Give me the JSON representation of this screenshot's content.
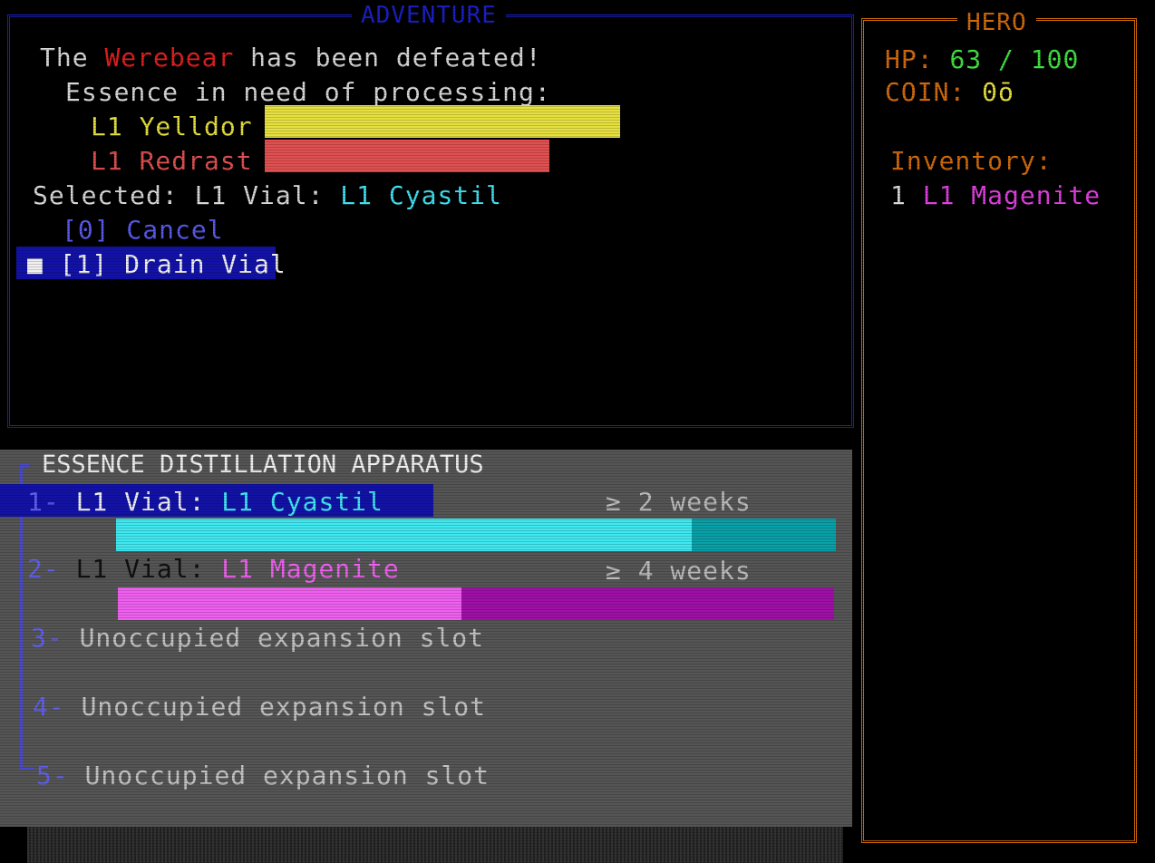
{
  "adventure": {
    "title": "ADVENTURE",
    "line1": {
      "prefix": "The ",
      "enemy": "Werebear",
      "suffix": " has been defeated!"
    },
    "essence_heading": "Essence in need of processing:",
    "essences": [
      {
        "label": "L1 Yelldor",
        "color": "#e6e040",
        "fill": 1.0
      },
      {
        "label": "L1 Redrast",
        "color": "#e05050",
        "fill": 0.8
      }
    ],
    "selected_prefix": "Selected: L1 Vial: ",
    "selected_value": "L1 Cyastil",
    "options": [
      {
        "label": "[0] Cancel"
      },
      {
        "label": "[1] Drain Vial",
        "marker": "■"
      }
    ]
  },
  "hero": {
    "title": "HERO",
    "hp_label": "HP: ",
    "hp_value": "63 / 100",
    "coin_label": "COIN: ",
    "coin_value": "0ō",
    "inventory_label": "Inventory:",
    "inventory": [
      {
        "qty": "1",
        "name": "L1 Magenite",
        "color": "#e040e0"
      }
    ]
  },
  "apparatus": {
    "title": "ESSENCE DISTILLATION APPARATUS",
    "slots": [
      {
        "num": "1-",
        "prefix": "L1 Vial: ",
        "name": "L1 Cyastil",
        "time": "≥ 2 weeks",
        "progress": 0.8,
        "color": "#40e8f0",
        "dark": "#0aa0a8"
      },
      {
        "num": "2-",
        "prefix": "L1 Vial: ",
        "name": "L1 Magenite",
        "time": "≥ 4 weeks",
        "progress": 0.48,
        "color": "#f060f0",
        "dark": "#a010a8"
      },
      {
        "num": "3-",
        "text": "Unoccupied expansion slot"
      },
      {
        "num": "4-",
        "text": "Unoccupied expansion slot"
      },
      {
        "num": "5-",
        "text": "Unoccupied expansion slot"
      }
    ]
  },
  "colors": {
    "adventure_border": "#1a20c8",
    "hero_border": "#d06a0c",
    "highlight": "#1212a8"
  }
}
